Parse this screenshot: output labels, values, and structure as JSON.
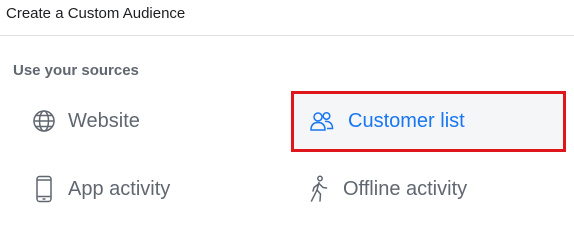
{
  "header": {
    "title": "Create a Custom Audience"
  },
  "sources": {
    "label": "Use your sources",
    "items": [
      {
        "label": "Website",
        "icon": "globe-icon"
      },
      {
        "label": "Customer list",
        "icon": "people-icon",
        "selected": true
      },
      {
        "label": "App activity",
        "icon": "mobile-phone-icon"
      },
      {
        "label": "Offline activity",
        "icon": "walking-person-icon"
      }
    ]
  },
  "colors": {
    "highlight_border": "#e0161d",
    "selected_text": "#1877f2",
    "muted_text": "#606770"
  }
}
